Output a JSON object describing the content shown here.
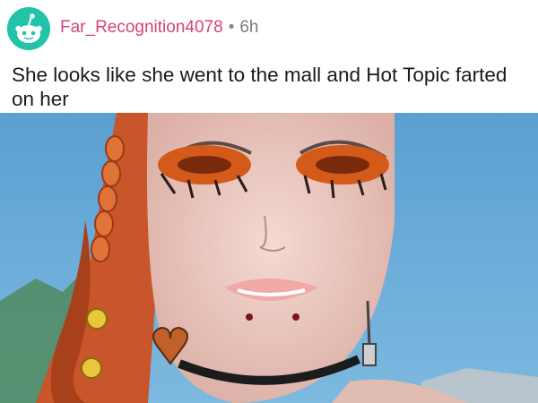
{
  "comment": {
    "username": "Far_Recognition4078",
    "separator": "•",
    "timestamp": "6h",
    "text": "She looks like she went to the mall and Hot Topic farted on her"
  },
  "icons": {
    "avatar": "snoo-avatar-icon"
  },
  "colors": {
    "username": "#d6427a",
    "avatar_bg": "#22c3a8",
    "sky": "#5fa4d4",
    "hair": "#c8562a"
  }
}
